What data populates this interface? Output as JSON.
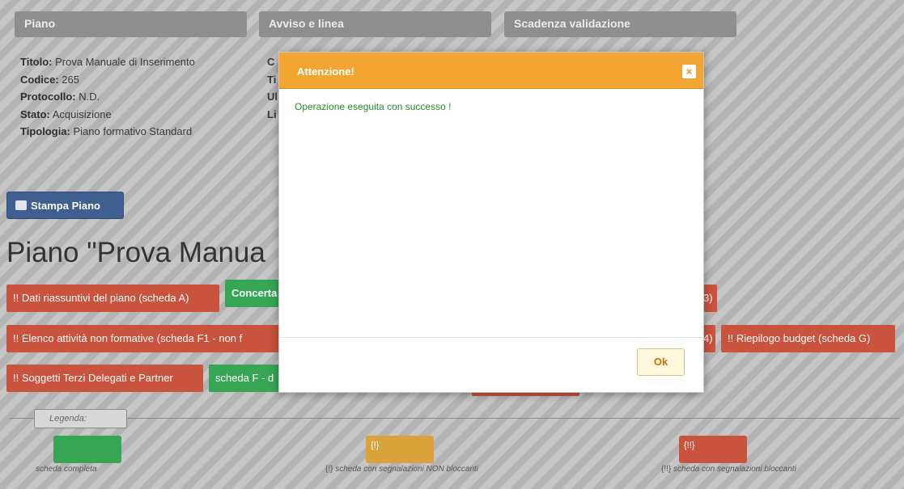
{
  "panels": {
    "piano": "Piano",
    "avviso": "Avviso e linea",
    "scadenza": "Scadenza validazione"
  },
  "info": {
    "titolo_label": "Titolo:",
    "titolo_value": "Prova Manuale di Inserimento",
    "codice_label": "Codice:",
    "codice_value": "265",
    "protocollo_label": "Protocollo:",
    "protocollo_value": "N.D.",
    "stato_label": "Stato:",
    "stato_value": "Acquisizione",
    "tipologia_label": "Tipologia:",
    "tipologia_value": "Piano formativo Standard",
    "col2": [
      "C",
      "Ti",
      "Ul",
      "Li"
    ]
  },
  "print_button": "Stampa Piano",
  "page_title": "Piano \"Prova Manua",
  "tags": [
    {
      "text": "!! Dati riassuntivi del piano (scheda A)",
      "color": "#c9533d"
    },
    {
      "text": "Concerta",
      "color": "#36a654"
    },
    {
      "text": "3)",
      "color": "#c9533d"
    },
    {
      "text": "!! Elenco attività non formative (scheda F1 - non f",
      "color": "#c9533d"
    },
    {
      "text": "4)",
      "color": "#c9533d"
    },
    {
      "text": "!! Riepilogo budget (scheda G)",
      "color": "#c9533d"
    },
    {
      "text": "!! Soggetti Terzi Delegati e Partner",
      "color": "#c9533d"
    },
    {
      "text": "scheda F - d",
      "color": "#36a654"
    }
  ],
  "legend": {
    "label": "Legenda:",
    "items": [
      {
        "swatch": "",
        "text": "scheda completa",
        "color": "#36a654"
      },
      {
        "swatch": "{!}",
        "text_prefix": "{!}",
        "text": "scheda con segnalazioni NON bloccanti",
        "color": "#d9a23a"
      },
      {
        "swatch": "{!!}",
        "text_prefix": "{!!}",
        "text": "scheda con segnalazioni bloccanti",
        "color": "#c9533d"
      }
    ]
  },
  "modal": {
    "title": "Attenzione!",
    "close": "×",
    "message": "Operazione eseguita con successo !",
    "ok": "Ok"
  }
}
